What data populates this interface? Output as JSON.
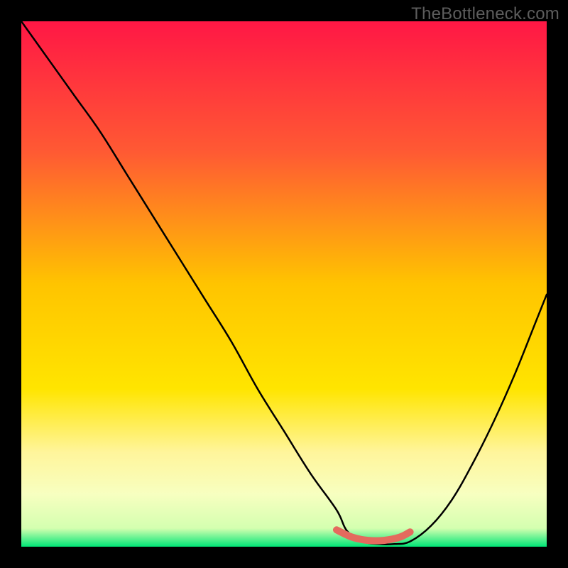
{
  "watermark": "TheBottleneck.com",
  "chart_data": {
    "type": "line",
    "title": "",
    "xlabel": "",
    "ylabel": "",
    "xlim": [
      0,
      100
    ],
    "ylim": [
      0,
      100
    ],
    "background_gradient": {
      "stops": [
        {
          "offset": 0.0,
          "color": "#ff1745"
        },
        {
          "offset": 0.25,
          "color": "#ff5a33"
        },
        {
          "offset": 0.5,
          "color": "#ffc400"
        },
        {
          "offset": 0.7,
          "color": "#ffe500"
        },
        {
          "offset": 0.82,
          "color": "#fff59b"
        },
        {
          "offset": 0.9,
          "color": "#f7ffc0"
        },
        {
          "offset": 0.965,
          "color": "#d4ffb0"
        },
        {
          "offset": 1.0,
          "color": "#00e676"
        }
      ]
    },
    "series": [
      {
        "name": "bottleneck-curve",
        "color": "#000000",
        "x": [
          0,
          5,
          10,
          15,
          20,
          25,
          30,
          35,
          40,
          45,
          50,
          55,
          60,
          62,
          65,
          68,
          71,
          74,
          78,
          82,
          86,
          90,
          94,
          98,
          100
        ],
        "y": [
          100,
          93,
          86,
          79,
          71,
          63,
          55,
          47,
          39,
          30,
          22,
          14,
          7,
          3,
          1,
          0.5,
          0.5,
          1,
          4,
          9,
          16,
          24,
          33,
          43,
          48
        ]
      },
      {
        "name": "optimal-band",
        "color": "#e46a5e",
        "stroke_width": 10,
        "x": [
          60,
          63,
          66,
          69,
          72,
          74
        ],
        "y": [
          3.2,
          1.8,
          1.2,
          1.2,
          1.8,
          2.8
        ]
      }
    ]
  }
}
